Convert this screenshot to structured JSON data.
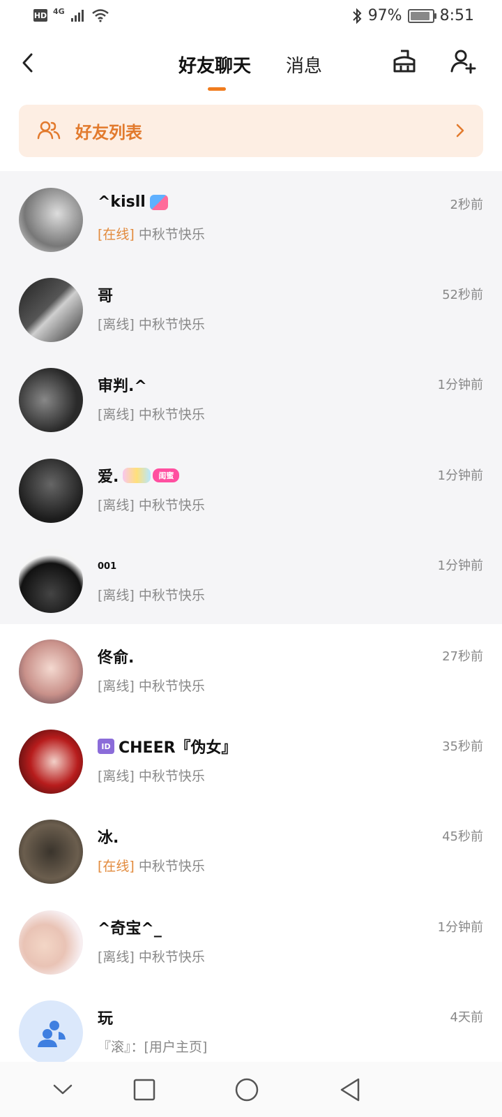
{
  "status_bar": {
    "hd": "HD",
    "network": "4G",
    "battery_percent": "97%",
    "battery_level": 0.97,
    "time": "8:51"
  },
  "header": {
    "tabs": [
      {
        "label": "好友聊天",
        "active": true
      },
      {
        "label": "消息",
        "active": false
      }
    ],
    "accent_color": "#f07c1e"
  },
  "friend_list_banner": {
    "label": "好友列表"
  },
  "chats": [
    {
      "name": "^kisll",
      "time": "2秒前",
      "status": "[在线]",
      "online": true,
      "preview": "中秋节快乐",
      "pinned": true
    },
    {
      "name": "哥",
      "time": "52秒前",
      "status": "[离线]",
      "online": false,
      "preview": "中秋节快乐",
      "pinned": true
    },
    {
      "name": "审判.^",
      "time": "1分钟前",
      "status": "[离线]",
      "online": false,
      "preview": "中秋节快乐",
      "pinned": true
    },
    {
      "name": "爱.",
      "badge": "闺蜜",
      "time": "1分钟前",
      "status": "[离线]",
      "online": false,
      "preview": "中秋节快乐",
      "pinned": true
    },
    {
      "name": "001",
      "time": "1分钟前",
      "status": "[离线]",
      "online": false,
      "preview": "中秋节快乐",
      "pinned": true
    },
    {
      "name": "佟俞.",
      "time": "27秒前",
      "status": "[离线]",
      "online": false,
      "preview": "中秋节快乐",
      "pinned": false
    },
    {
      "name": "CHEER『伪女』",
      "id_badge": "ID",
      "time": "35秒前",
      "status": "[离线]",
      "online": false,
      "preview": "中秋节快乐",
      "pinned": false
    },
    {
      "name": "冰.",
      "time": "45秒前",
      "status": "[在线]",
      "online": true,
      "preview": "中秋节快乐",
      "pinned": false
    },
    {
      "name": "^奇宝^_",
      "time": "1分钟前",
      "status": "[离线]",
      "online": false,
      "preview": "中秋节快乐",
      "pinned": false
    },
    {
      "name": "玩",
      "time": "4天前",
      "status": "",
      "online": false,
      "preview": "『滚』：[用户主页]",
      "pinned": false
    }
  ]
}
